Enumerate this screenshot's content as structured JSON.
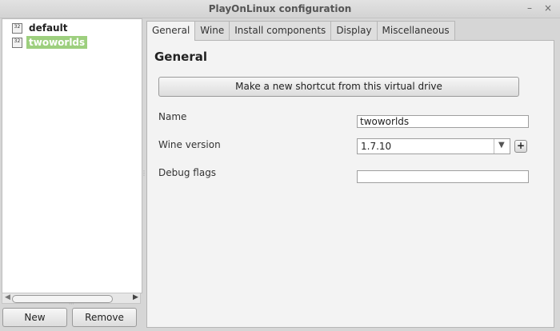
{
  "window": {
    "title": "PlayOnLinux configuration",
    "minimize_glyph": "–",
    "close_glyph": "×"
  },
  "sidebar": {
    "items": [
      {
        "label": "default",
        "icon": "32-bit-drive-icon",
        "icon_text": "32",
        "selected": false
      },
      {
        "label": "twoworlds",
        "icon": "32-bit-drive-icon",
        "icon_text": "32",
        "selected": true
      }
    ],
    "new_label": "New",
    "remove_label": "Remove"
  },
  "tabs": [
    {
      "label": "General",
      "active": true
    },
    {
      "label": "Wine",
      "active": false
    },
    {
      "label": "Install components",
      "active": false
    },
    {
      "label": "Display",
      "active": false
    },
    {
      "label": "Miscellaneous",
      "active": false
    }
  ],
  "general": {
    "heading": "General",
    "shortcut_button": "Make a new shortcut from this virtual drive",
    "name_label": "Name",
    "name_value": "twoworlds",
    "wine_version_label": "Wine version",
    "wine_version_value": "1.7.10",
    "debug_flags_label": "Debug flags",
    "debug_flags_value": ""
  },
  "colors": {
    "selection": "#9dcf7e",
    "background": "#d6d6d6",
    "panel": "#f3f3f3"
  }
}
